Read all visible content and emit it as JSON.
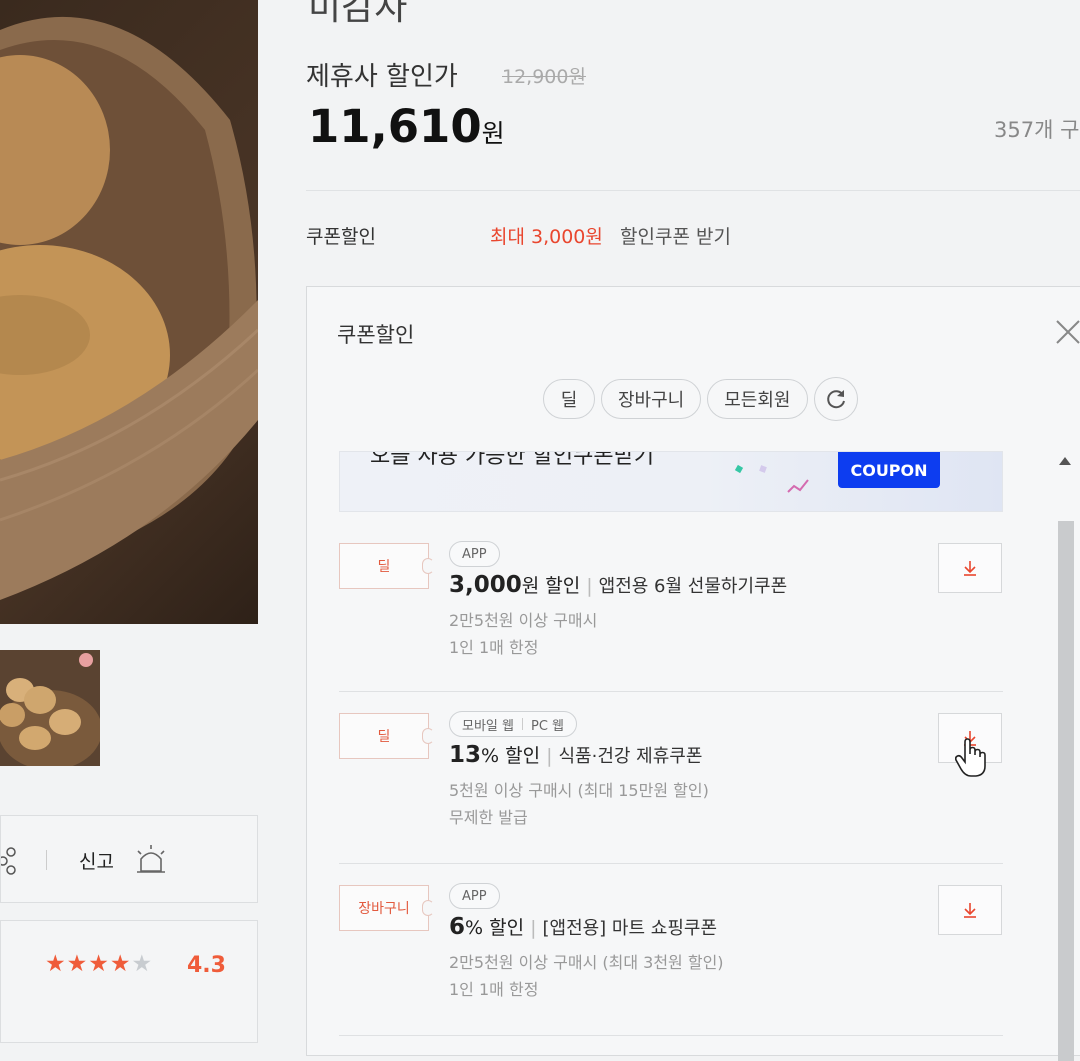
{
  "product": {
    "name": "미감자",
    "partner_price_label": "제휴사 할인가",
    "original_price": "12,900원",
    "price": "11,610",
    "price_unit": "원",
    "stock_text": "357개 구"
  },
  "coupon_summary": {
    "label": "쿠폰할인",
    "max_text": "최대 3,000원",
    "get_text": "할인쿠폰 받기"
  },
  "panel": {
    "title": "쿠폰할인",
    "filters": [
      "딜",
      "장바구니",
      "모든회원"
    ],
    "banner": {
      "text": "오늘 사용 가능한 할인쿠폰받기",
      "badge": "COUPON"
    },
    "coupons": [
      {
        "tag": "딜",
        "platforms": [
          "APP"
        ],
        "amount": "3,000",
        "unit": "원 할인",
        "name": "앱전용 6월 선물하기쿠폰",
        "condition": "2만5천원 이상 구매시",
        "limit": "1인 1매 한정"
      },
      {
        "tag": "딜",
        "platforms": [
          "모바일 웹",
          "PC 웹"
        ],
        "amount": "13",
        "unit": "% 할인",
        "name": "식품·건강 제휴쿠폰",
        "condition": "5천원 이상 구매시 (최대 15만원 할인)",
        "limit": "무제한 발급"
      },
      {
        "tag": "장바구니",
        "platforms": [
          "APP"
        ],
        "amount": "6",
        "unit": "% 할인",
        "name": "[앱전용] 마트 쇼핑쿠폰",
        "condition": "2만5천원 이상 구매시 (최대 3천원 할인)",
        "limit": "1인 1매 한정"
      }
    ]
  },
  "sidebar": {
    "report_label": "신고",
    "rating": "4.3",
    "rating_value": 4.3,
    "rating_max": 5
  },
  "colors": {
    "accent_red": "#e9462e",
    "star": "#ef5c3a",
    "coupon_blue": "#0d3df0"
  },
  "icons": [
    "share-icon",
    "siren-icon",
    "close-icon",
    "refresh-icon",
    "download-icon",
    "hand-cursor-icon",
    "scroll-up-icon"
  ]
}
